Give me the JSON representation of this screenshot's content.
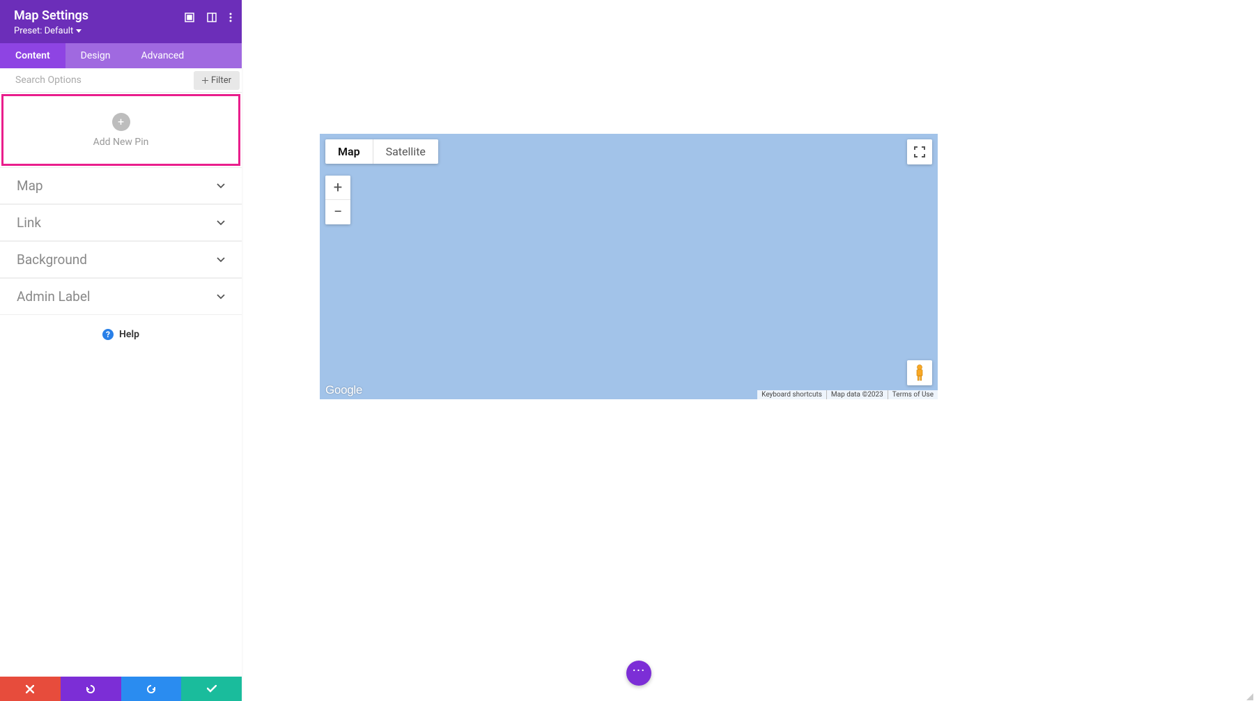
{
  "header": {
    "title": "Map Settings",
    "preset_label": "Preset: Default"
  },
  "tabs": {
    "content": "Content",
    "design": "Design",
    "advanced": "Advanced"
  },
  "search": {
    "placeholder": "Search Options",
    "filter_label": "Filter"
  },
  "add_pin": {
    "label": "Add New Pin"
  },
  "accordion": {
    "map": "Map",
    "link": "Link",
    "background": "Background",
    "admin_label": "Admin Label"
  },
  "help": {
    "label": "Help"
  },
  "map_widget": {
    "tab_map": "Map",
    "tab_satellite": "Satellite",
    "google_logo": "Google",
    "attr_shortcuts": "Keyboard shortcuts",
    "attr_data": "Map data ©2023",
    "attr_terms": "Terms of Use"
  }
}
